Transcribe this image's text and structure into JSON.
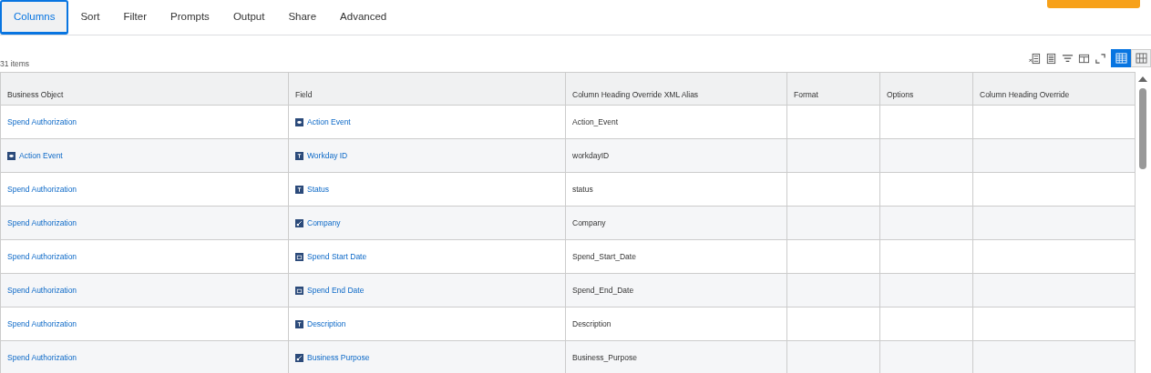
{
  "tabs": [
    {
      "label": "Columns",
      "selected": true
    },
    {
      "label": "Sort",
      "selected": false
    },
    {
      "label": "Filter",
      "selected": false
    },
    {
      "label": "Prompts",
      "selected": false
    },
    {
      "label": "Output",
      "selected": false
    },
    {
      "label": "Share",
      "selected": false
    },
    {
      "label": "Advanced",
      "selected": false
    }
  ],
  "item_count": "31 items",
  "view_toggle": [
    {
      "kind": "table",
      "selected": true
    },
    {
      "kind": "grid",
      "selected": false
    }
  ],
  "table": {
    "columns": [
      "Business Object",
      "Field",
      "Column Heading Override XML Alias",
      "Format",
      "Options",
      "Column Heading Override"
    ],
    "rows": [
      {
        "business_object": {
          "text": "Spend Authorization"
        },
        "field": {
          "text": "Action Event",
          "kind": "instance"
        },
        "alias": "Action_Event"
      },
      {
        "business_object": {
          "text": "Action Event",
          "kind": "instance"
        },
        "field": {
          "text": "Workday ID",
          "kind": "text"
        },
        "alias": "workdayID"
      },
      {
        "business_object": {
          "text": "Spend Authorization"
        },
        "field": {
          "text": "Status",
          "kind": "text"
        },
        "alias": "status"
      },
      {
        "business_object": {
          "text": "Spend Authorization"
        },
        "field": {
          "text": "Company",
          "kind": "relation"
        },
        "alias": "Company"
      },
      {
        "business_object": {
          "text": "Spend Authorization"
        },
        "field": {
          "text": "Spend Start Date",
          "kind": "date"
        },
        "alias": "Spend_Start_Date"
      },
      {
        "business_object": {
          "text": "Spend Authorization"
        },
        "field": {
          "text": "Spend End Date",
          "kind": "date"
        },
        "alias": "Spend_End_Date"
      },
      {
        "business_object": {
          "text": "Spend Authorization"
        },
        "field": {
          "text": "Description",
          "kind": "text"
        },
        "alias": "Description"
      },
      {
        "business_object": {
          "text": "Spend Authorization"
        },
        "field": {
          "text": "Business Purpose",
          "kind": "relation"
        },
        "alias": "Business_Purpose"
      }
    ]
  }
}
